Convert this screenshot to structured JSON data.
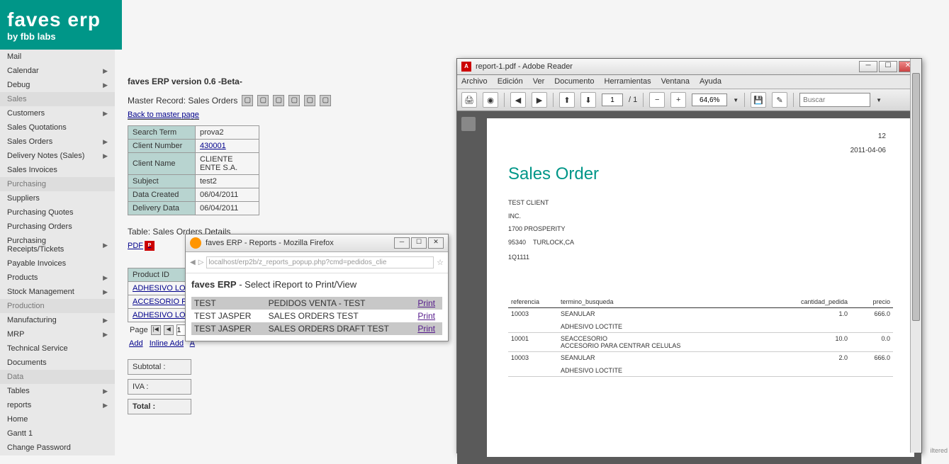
{
  "logo": {
    "main": "faves erp",
    "sub": "by fbb labs"
  },
  "menu": {
    "top": [
      "Mail",
      "Calendar",
      "Debug"
    ],
    "sales_hdr": "Sales",
    "sales": [
      "Customers",
      "Sales Quotations",
      "Sales Orders",
      "Delivery Notes (Sales)",
      "Sales Invoices"
    ],
    "purch_hdr": "Purchasing",
    "purch": [
      "Suppliers",
      "Purchasing Quotes",
      "Purchasing Orders",
      "Purchasing Receipts/Tickets",
      "Payable Invoices"
    ],
    "prod": [
      "Products",
      "Stock Management"
    ],
    "production_hdr": "Production",
    "production": [
      "Manufacturing",
      "MRP"
    ],
    "misc": [
      "Technical Service",
      "Documents"
    ],
    "data_hdr": "Data",
    "data": [
      "Tables",
      "reports"
    ],
    "bottom": [
      "Home",
      "Gantt 1",
      "Change Password"
    ]
  },
  "content": {
    "version": "faves ERP version 0.6 -Beta-",
    "master": "Master Record: Sales Orders",
    "back": "Back to master page",
    "info": [
      {
        "k": "Search Term",
        "v": "prova2",
        "link": false
      },
      {
        "k": "Client Number",
        "v": "430001",
        "link": true
      },
      {
        "k": "Client Name",
        "v": "CLIENTE ENTE S.A.",
        "link": false
      },
      {
        "k": "Subject",
        "v": "test2",
        "link": false
      },
      {
        "k": "Data Created",
        "v": "06/04/2011",
        "link": false
      },
      {
        "k": "Delivery Data",
        "v": "06/04/2011",
        "link": false
      }
    ],
    "table_title": "Table: Sales Orders Details",
    "pdf": "PDF",
    "header": "Product ID",
    "details": [
      "ADHESIVO LOCTIT",
      "ACCESORIO PARA",
      "ADHESIVO LOCTIT"
    ],
    "pager": {
      "page": "Page",
      "val": "1",
      "add": "Add",
      "inline": "Inline Add",
      "a": "A"
    },
    "summary": {
      "subtotal": "Subtotal :",
      "iva": "IVA :",
      "total": "Total :"
    }
  },
  "firefox": {
    "title": "faves ERP - Reports - Mozilla Firefox",
    "url": "localhost/erp2b/z_reports_popup.php?cmd=pedidos_clie",
    "heading_bold": "faves ERP",
    "heading_rest": " - Select iReport to Print/View",
    "rows": [
      {
        "c1": "TEST",
        "c2": "PEDIDOS VENTA - TEST",
        "c3": "Print"
      },
      {
        "c1": "TEST JASPER",
        "c2": "SALES ORDERS TEST",
        "c3": "Print"
      },
      {
        "c1": "TEST JASPER",
        "c2": "SALES ORDERS DRAFT TEST",
        "c3": "Print"
      }
    ]
  },
  "reader": {
    "title": "report-1.pdf - Adobe Reader",
    "menu": [
      "Archivo",
      "Edición",
      "Ver",
      "Documento",
      "Herramientas",
      "Ventana",
      "Ayuda"
    ],
    "page_cur": "1",
    "page_total": "/ 1",
    "zoom": "64,6%",
    "search": "Buscar",
    "doc": {
      "num": "12",
      "date": "2011-04-06",
      "title": "Sales Order",
      "addr1": "TEST CLIENT",
      "addr2": "INC.",
      "addr3": "1700 PROSPERITY",
      "zip": "95340",
      "city": "TURLOCK,CA",
      "q": "1Q1111",
      "hdr": {
        "ref": "referencia",
        "term": "termino_busqueda",
        "qty": "cantidad_pedida",
        "price": "precio"
      },
      "rows": [
        {
          "ref": "10003",
          "t1": "SEANULAR",
          "t2": "ADHESIVO LOCTITE",
          "qty": "1.0",
          "price": "666.0"
        },
        {
          "ref": "10001",
          "t1": "SEACCESORIO",
          "t2": "ACCESORIO PARA CENTRAR CELULAS",
          "qty": "10.0",
          "price": "0.0"
        },
        {
          "ref": "10003",
          "t1": "SEANULAR",
          "t2": "ADHESIVO LOCTITE",
          "qty": "2.0",
          "price": "666.0"
        }
      ]
    }
  },
  "corner": "iltered"
}
